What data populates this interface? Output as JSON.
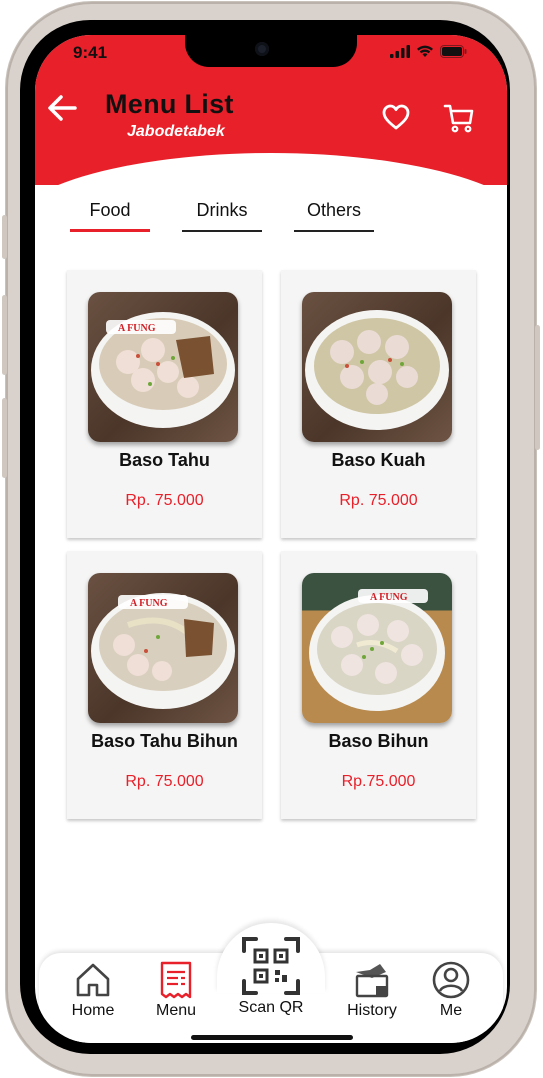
{
  "status_bar": {
    "time": "9:41"
  },
  "header": {
    "title": "Menu List",
    "subtitle": "Jabodetabek",
    "back_icon": "arrow-left-icon",
    "favorite_icon": "heart-icon",
    "cart_icon": "cart-icon",
    "color": "#e8202a"
  },
  "tabs": [
    {
      "label": "Food",
      "active": true
    },
    {
      "label": "Drinks",
      "active": false
    },
    {
      "label": "Others",
      "active": false
    }
  ],
  "items": [
    {
      "name": "Baso Tahu",
      "price": "Rp. 75.000"
    },
    {
      "name": "Baso Kuah",
      "price": "Rp. 75.000"
    },
    {
      "name": "Baso Tahu Bihun",
      "price": "Rp. 75.000"
    },
    {
      "name": "Baso Bihun",
      "price": "Rp.75.000"
    }
  ],
  "bowl_brand": "A FUNG",
  "bottom_nav": [
    {
      "label": "Home",
      "icon": "home-icon"
    },
    {
      "label": "Menu",
      "icon": "menu-receipt-icon"
    },
    {
      "label": "Scan QR",
      "icon": "qr-code-icon"
    },
    {
      "label": "History",
      "icon": "history-icon"
    },
    {
      "label": "Me",
      "icon": "profile-icon"
    }
  ],
  "accent_color": "#e8202a"
}
